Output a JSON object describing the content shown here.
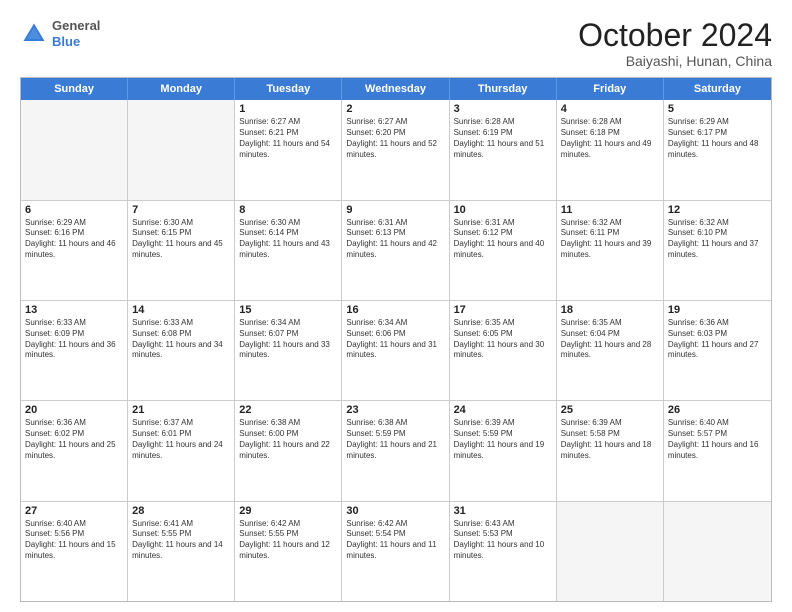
{
  "header": {
    "logo": {
      "general": "General",
      "blue": "Blue"
    },
    "title": "October 2024",
    "location": "Baiyashi, Hunan, China"
  },
  "days_of_week": [
    "Sunday",
    "Monday",
    "Tuesday",
    "Wednesday",
    "Thursday",
    "Friday",
    "Saturday"
  ],
  "weeks": [
    [
      {
        "day": "",
        "sunrise": "",
        "sunset": "",
        "daylight": "",
        "empty": true
      },
      {
        "day": "",
        "sunrise": "",
        "sunset": "",
        "daylight": "",
        "empty": true
      },
      {
        "day": "1",
        "sunrise": "Sunrise: 6:27 AM",
        "sunset": "Sunset: 6:21 PM",
        "daylight": "Daylight: 11 hours and 54 minutes."
      },
      {
        "day": "2",
        "sunrise": "Sunrise: 6:27 AM",
        "sunset": "Sunset: 6:20 PM",
        "daylight": "Daylight: 11 hours and 52 minutes."
      },
      {
        "day": "3",
        "sunrise": "Sunrise: 6:28 AM",
        "sunset": "Sunset: 6:19 PM",
        "daylight": "Daylight: 11 hours and 51 minutes."
      },
      {
        "day": "4",
        "sunrise": "Sunrise: 6:28 AM",
        "sunset": "Sunset: 6:18 PM",
        "daylight": "Daylight: 11 hours and 49 minutes."
      },
      {
        "day": "5",
        "sunrise": "Sunrise: 6:29 AM",
        "sunset": "Sunset: 6:17 PM",
        "daylight": "Daylight: 11 hours and 48 minutes."
      }
    ],
    [
      {
        "day": "6",
        "sunrise": "Sunrise: 6:29 AM",
        "sunset": "Sunset: 6:16 PM",
        "daylight": "Daylight: 11 hours and 46 minutes."
      },
      {
        "day": "7",
        "sunrise": "Sunrise: 6:30 AM",
        "sunset": "Sunset: 6:15 PM",
        "daylight": "Daylight: 11 hours and 45 minutes."
      },
      {
        "day": "8",
        "sunrise": "Sunrise: 6:30 AM",
        "sunset": "Sunset: 6:14 PM",
        "daylight": "Daylight: 11 hours and 43 minutes."
      },
      {
        "day": "9",
        "sunrise": "Sunrise: 6:31 AM",
        "sunset": "Sunset: 6:13 PM",
        "daylight": "Daylight: 11 hours and 42 minutes."
      },
      {
        "day": "10",
        "sunrise": "Sunrise: 6:31 AM",
        "sunset": "Sunset: 6:12 PM",
        "daylight": "Daylight: 11 hours and 40 minutes."
      },
      {
        "day": "11",
        "sunrise": "Sunrise: 6:32 AM",
        "sunset": "Sunset: 6:11 PM",
        "daylight": "Daylight: 11 hours and 39 minutes."
      },
      {
        "day": "12",
        "sunrise": "Sunrise: 6:32 AM",
        "sunset": "Sunset: 6:10 PM",
        "daylight": "Daylight: 11 hours and 37 minutes."
      }
    ],
    [
      {
        "day": "13",
        "sunrise": "Sunrise: 6:33 AM",
        "sunset": "Sunset: 6:09 PM",
        "daylight": "Daylight: 11 hours and 36 minutes."
      },
      {
        "day": "14",
        "sunrise": "Sunrise: 6:33 AM",
        "sunset": "Sunset: 6:08 PM",
        "daylight": "Daylight: 11 hours and 34 minutes."
      },
      {
        "day": "15",
        "sunrise": "Sunrise: 6:34 AM",
        "sunset": "Sunset: 6:07 PM",
        "daylight": "Daylight: 11 hours and 33 minutes."
      },
      {
        "day": "16",
        "sunrise": "Sunrise: 6:34 AM",
        "sunset": "Sunset: 6:06 PM",
        "daylight": "Daylight: 11 hours and 31 minutes."
      },
      {
        "day": "17",
        "sunrise": "Sunrise: 6:35 AM",
        "sunset": "Sunset: 6:05 PM",
        "daylight": "Daylight: 11 hours and 30 minutes."
      },
      {
        "day": "18",
        "sunrise": "Sunrise: 6:35 AM",
        "sunset": "Sunset: 6:04 PM",
        "daylight": "Daylight: 11 hours and 28 minutes."
      },
      {
        "day": "19",
        "sunrise": "Sunrise: 6:36 AM",
        "sunset": "Sunset: 6:03 PM",
        "daylight": "Daylight: 11 hours and 27 minutes."
      }
    ],
    [
      {
        "day": "20",
        "sunrise": "Sunrise: 6:36 AM",
        "sunset": "Sunset: 6:02 PM",
        "daylight": "Daylight: 11 hours and 25 minutes."
      },
      {
        "day": "21",
        "sunrise": "Sunrise: 6:37 AM",
        "sunset": "Sunset: 6:01 PM",
        "daylight": "Daylight: 11 hours and 24 minutes."
      },
      {
        "day": "22",
        "sunrise": "Sunrise: 6:38 AM",
        "sunset": "Sunset: 6:00 PM",
        "daylight": "Daylight: 11 hours and 22 minutes."
      },
      {
        "day": "23",
        "sunrise": "Sunrise: 6:38 AM",
        "sunset": "Sunset: 5:59 PM",
        "daylight": "Daylight: 11 hours and 21 minutes."
      },
      {
        "day": "24",
        "sunrise": "Sunrise: 6:39 AM",
        "sunset": "Sunset: 5:59 PM",
        "daylight": "Daylight: 11 hours and 19 minutes."
      },
      {
        "day": "25",
        "sunrise": "Sunrise: 6:39 AM",
        "sunset": "Sunset: 5:58 PM",
        "daylight": "Daylight: 11 hours and 18 minutes."
      },
      {
        "day": "26",
        "sunrise": "Sunrise: 6:40 AM",
        "sunset": "Sunset: 5:57 PM",
        "daylight": "Daylight: 11 hours and 16 minutes."
      }
    ],
    [
      {
        "day": "27",
        "sunrise": "Sunrise: 6:40 AM",
        "sunset": "Sunset: 5:56 PM",
        "daylight": "Daylight: 11 hours and 15 minutes."
      },
      {
        "day": "28",
        "sunrise": "Sunrise: 6:41 AM",
        "sunset": "Sunset: 5:55 PM",
        "daylight": "Daylight: 11 hours and 14 minutes."
      },
      {
        "day": "29",
        "sunrise": "Sunrise: 6:42 AM",
        "sunset": "Sunset: 5:55 PM",
        "daylight": "Daylight: 11 hours and 12 minutes."
      },
      {
        "day": "30",
        "sunrise": "Sunrise: 6:42 AM",
        "sunset": "Sunset: 5:54 PM",
        "daylight": "Daylight: 11 hours and 11 minutes."
      },
      {
        "day": "31",
        "sunrise": "Sunrise: 6:43 AM",
        "sunset": "Sunset: 5:53 PM",
        "daylight": "Daylight: 11 hours and 10 minutes."
      },
      {
        "day": "",
        "sunrise": "",
        "sunset": "",
        "daylight": "",
        "empty": true
      },
      {
        "day": "",
        "sunrise": "",
        "sunset": "",
        "daylight": "",
        "empty": true
      }
    ]
  ]
}
